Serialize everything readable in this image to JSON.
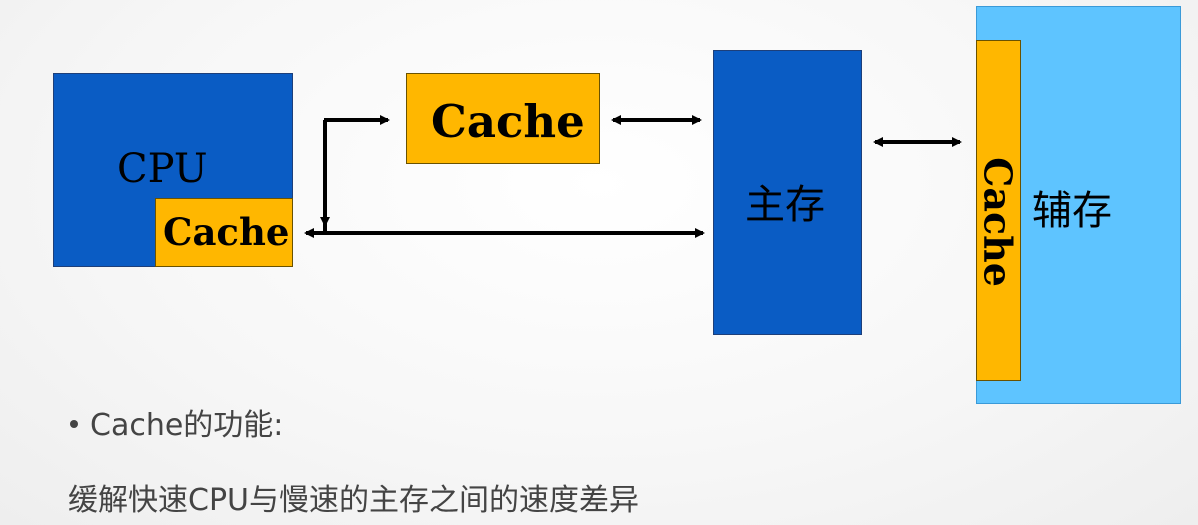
{
  "diagram": {
    "cpu_label": "CPU",
    "cpu_cache_label": "Cache",
    "cache_label": "Cache",
    "main_memory_label": "主存",
    "aux_cache_label": "Cache",
    "aux_memory_label": "辅存",
    "colors": {
      "blue": "#0a5cc4",
      "orange": "#ffb700",
      "light_blue": "#5ec4ff",
      "arrow": "#000000"
    }
  },
  "text": {
    "bullet": "Cache的功能:",
    "description": "缓解快速CPU与慢速的主存之间的速度差异"
  }
}
